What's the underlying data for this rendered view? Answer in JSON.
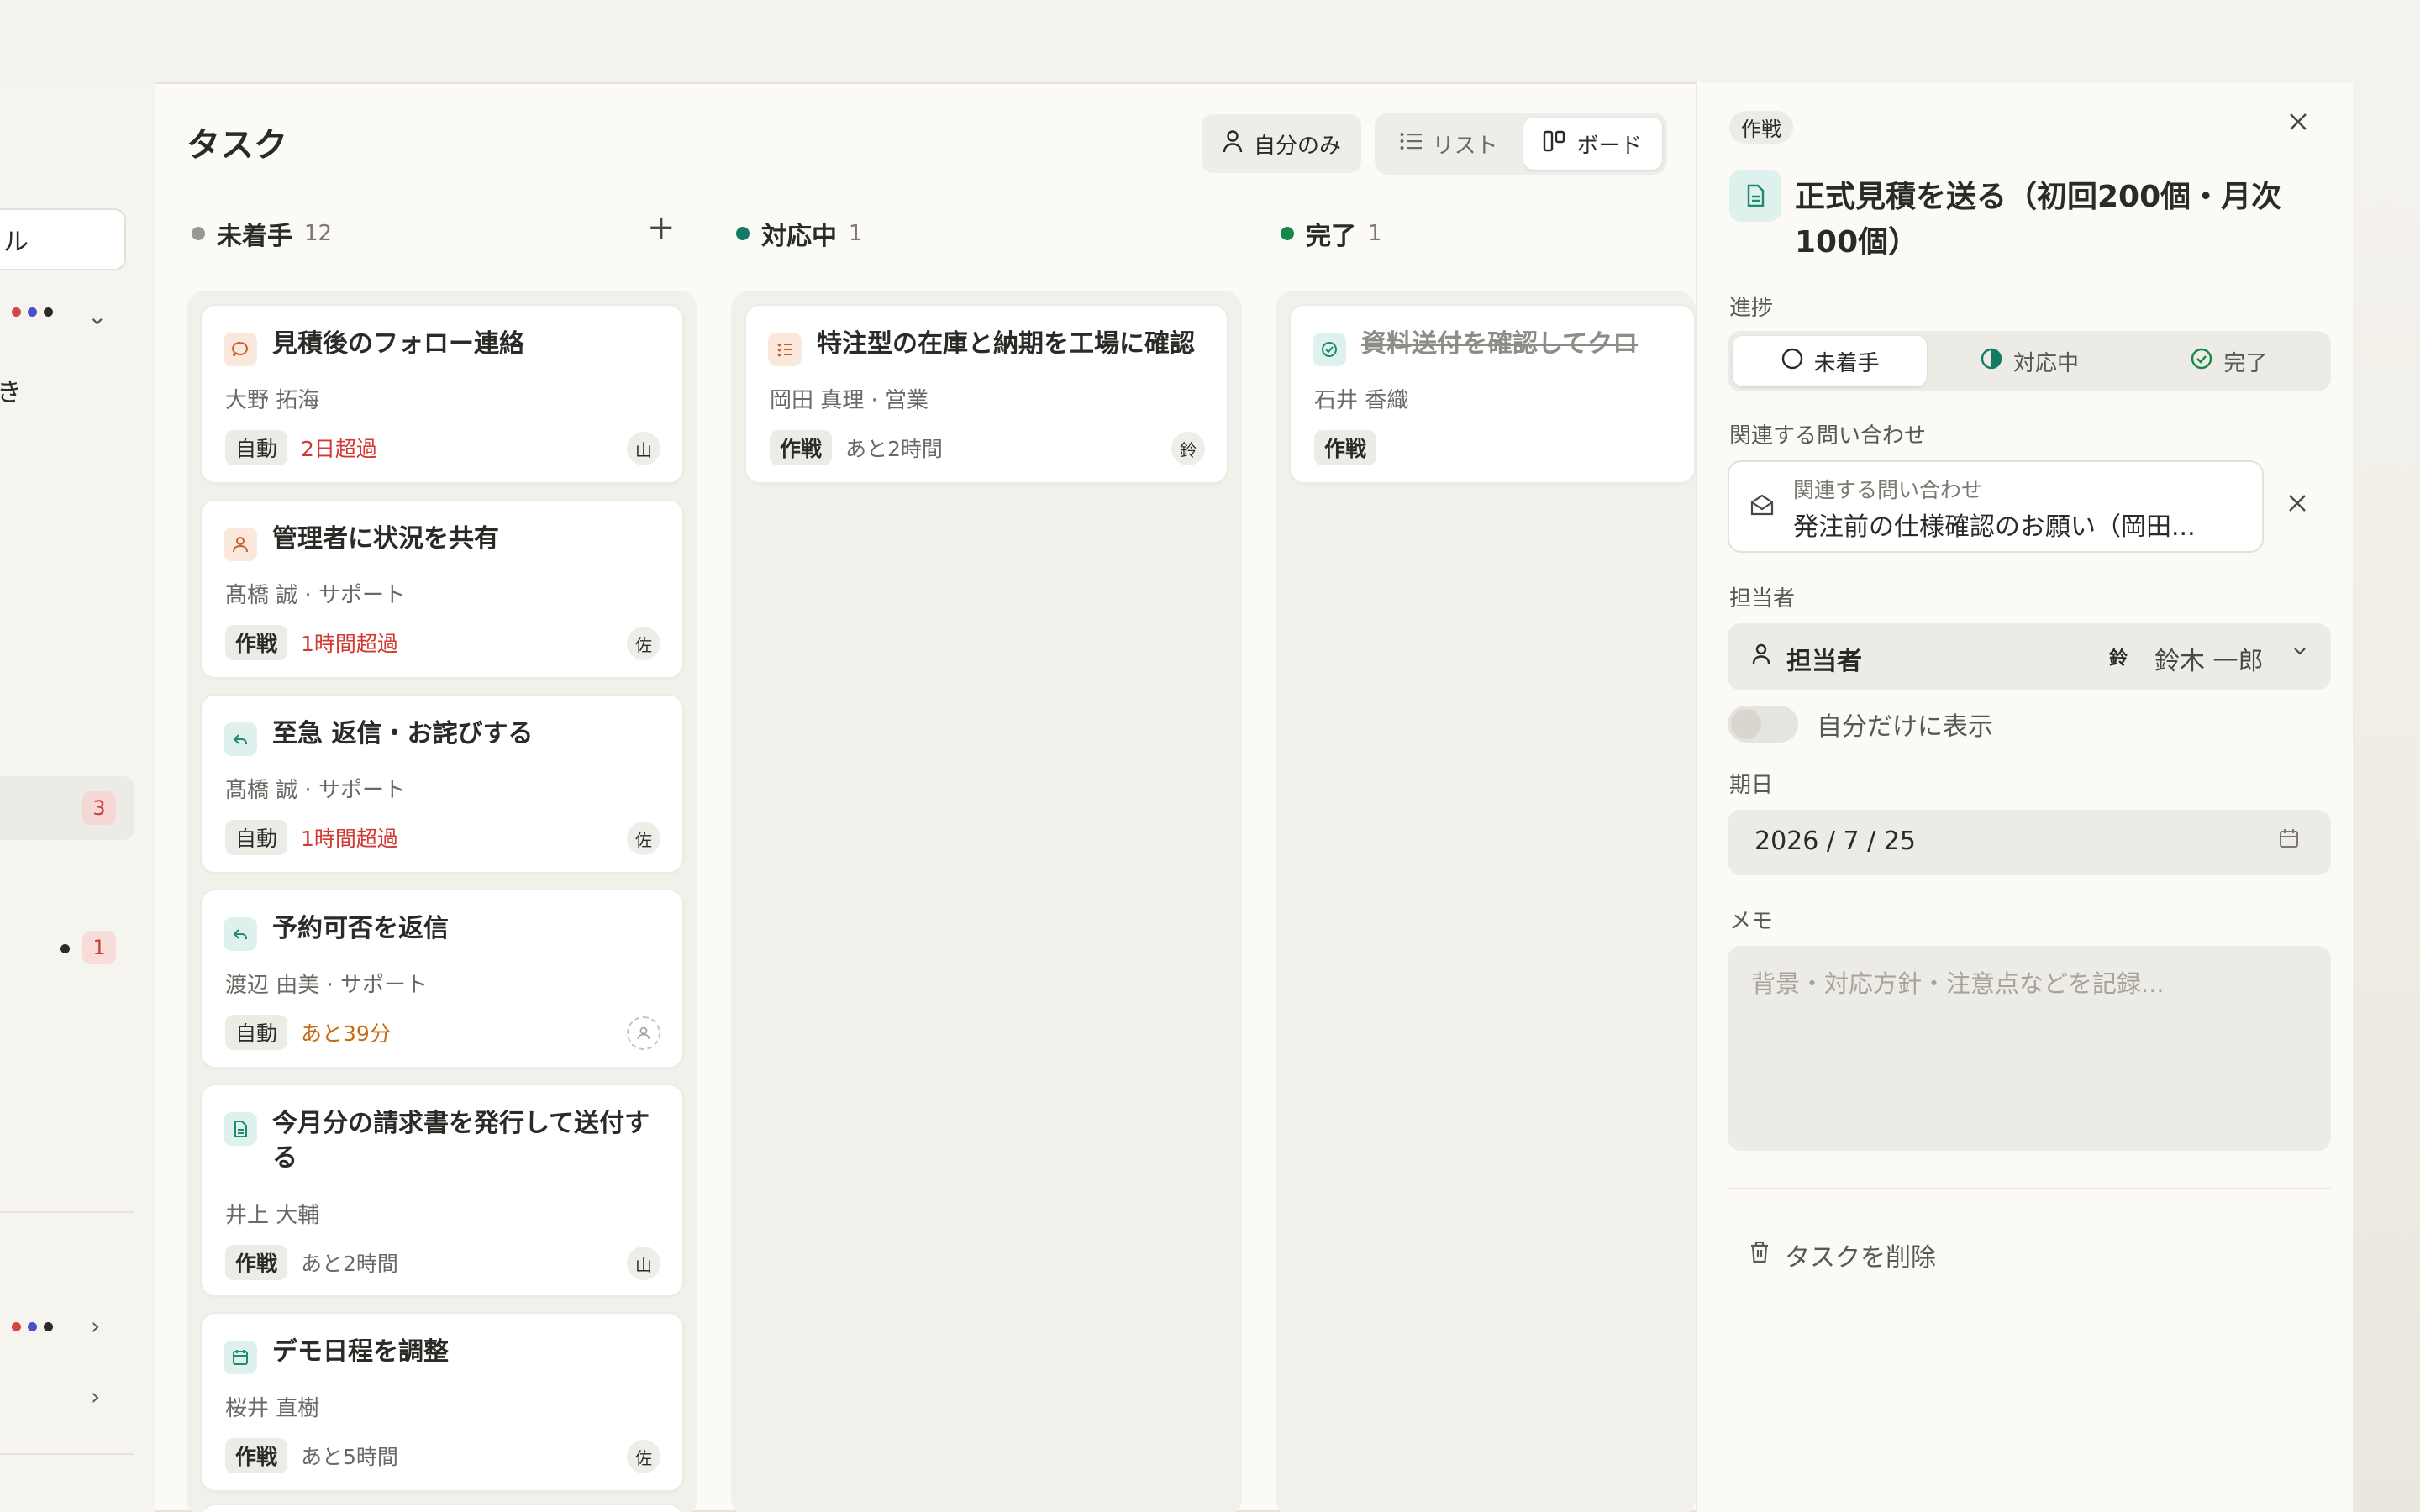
{
  "sidebar": {
    "input_fragment": "ル",
    "text_fragment": "き",
    "badge_active": "3",
    "badge_second": "1"
  },
  "header": {
    "title": "タスク",
    "self_only": "自分のみ",
    "view_list": "リスト",
    "view_board": "ボード"
  },
  "columns": [
    {
      "name": "未着手",
      "count": "12",
      "color": "#9a9893"
    },
    {
      "name": "対応中",
      "count": "1",
      "color": "#137a66"
    },
    {
      "name": "完了",
      "count": "1",
      "color": "#19874a"
    }
  ],
  "todo_cards": [
    {
      "title": "見積後のフォロー連絡",
      "sub": "大野 拓海",
      "tag": "自動",
      "status": "2日超過",
      "avatar": "山"
    },
    {
      "title": "管理者に状況を共有",
      "sub": "髙橋 誠 · サポート",
      "tag": "作戦",
      "status": "1時間超過",
      "avatar": "佐"
    },
    {
      "title": "至急 返信・お詫びする",
      "sub": "髙橋 誠 · サポート",
      "tag": "自動",
      "status": "1時間超過",
      "avatar": "佐"
    },
    {
      "title": "予約可否を返信",
      "sub": "渡辺 由美 · サポート",
      "tag": "自動",
      "status": "あと39分",
      "avatar": ""
    },
    {
      "title": "今月分の請求書を発行して送付する",
      "sub": "井上 大輔",
      "tag": "作戦",
      "status": "あと2時間",
      "avatar": "山"
    },
    {
      "title": "デモ日程を調整",
      "sub": "桜井 直樹",
      "tag": "作戦",
      "status": "あと5時間",
      "avatar": "佐"
    }
  ],
  "doing_cards": [
    {
      "title": "特注型の在庫と納期を工場に確認",
      "sub": "岡田 真理 · 営業",
      "tag": "作戦",
      "status": "あと2時間",
      "avatar": "鈴"
    }
  ],
  "done_cards": [
    {
      "title": "資料送付を確認してクロ",
      "sub": "石井 香織",
      "tag": "作戦"
    }
  ],
  "detail": {
    "tag": "作戦",
    "title": "正式見積を送る（初回200個・月次100個）",
    "progress_label": "進捗",
    "progress_options": [
      "未着手",
      "対応中",
      "完了"
    ],
    "inquiry_label": "関連する問い合わせ",
    "inquiry_small": "関連する問い合わせ",
    "inquiry_value": "発注前の仕様確認のお願い（岡田...",
    "assignee_section": "担当者",
    "assignee_label": "担当者",
    "assignee_avatar": "鈴",
    "assignee_name": "鈴木 一郎",
    "toggle_label": "自分だけに表示",
    "due_label": "期日",
    "due_value": "2026 / 7 / 25",
    "memo_label": "メモ",
    "memo_placeholder": "背景・対応方針・注意点などを記録...",
    "delete_label": "タスクを削除"
  }
}
